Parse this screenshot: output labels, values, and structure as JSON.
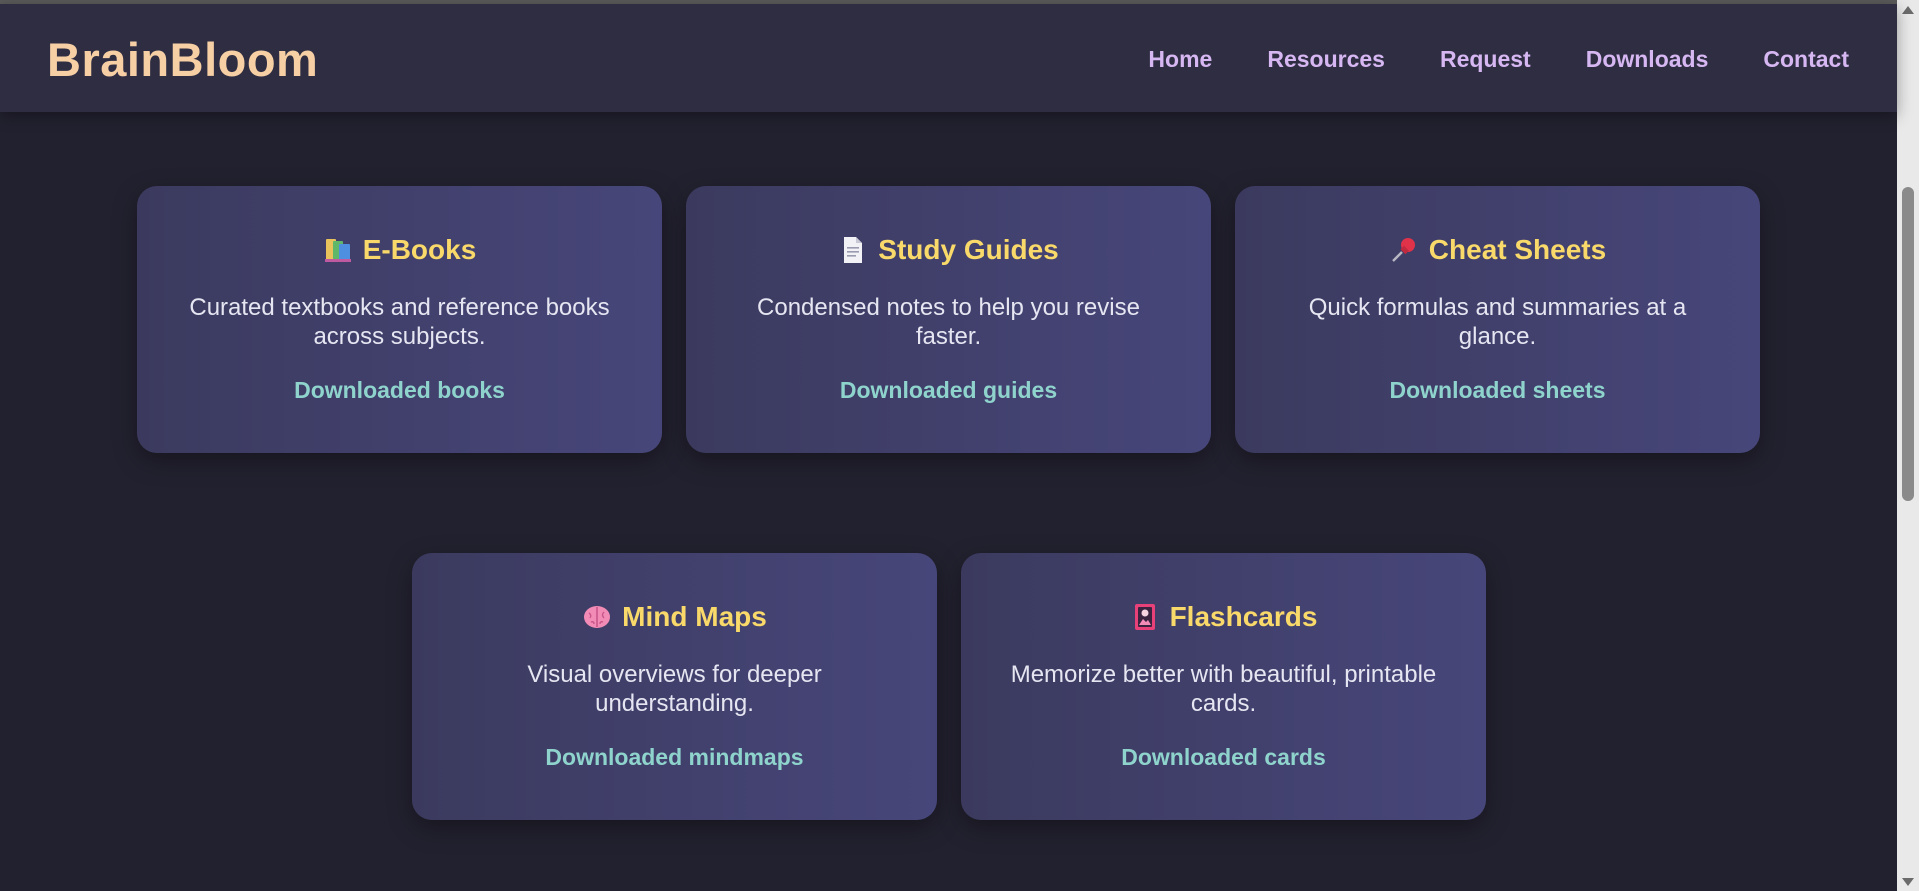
{
  "header": {
    "logo": "BrainBloom",
    "nav": [
      "Home",
      "Resources",
      "Request",
      "Downloads",
      "Contact"
    ]
  },
  "cards": [
    {
      "icon": "books-icon",
      "title": "E-Books",
      "description": "Curated textbooks and reference books across subjects.",
      "link": "Downloaded books"
    },
    {
      "icon": "page-icon",
      "title": "Study Guides",
      "description": "Condensed notes to help you revise faster.",
      "link": "Downloaded guides"
    },
    {
      "icon": "pushpin-icon",
      "title": "Cheat Sheets",
      "description": "Quick formulas and summaries at a glance.",
      "link": "Downloaded sheets"
    },
    {
      "icon": "brain-icon",
      "title": "Mind Maps",
      "description": "Visual overviews for deeper understanding.",
      "link": "Downloaded mindmaps"
    },
    {
      "icon": "card-icon",
      "title": "Flashcards",
      "description": "Memorize better with beautiful, printable cards.",
      "link": "Downloaded cards"
    }
  ],
  "colors": {
    "background": "#22212f",
    "header": "#2e2d42",
    "logo": "#f6cfa4",
    "nav": "#d6b7f2",
    "card_title": "#f8d96a",
    "card_link": "#8fd3cd"
  }
}
